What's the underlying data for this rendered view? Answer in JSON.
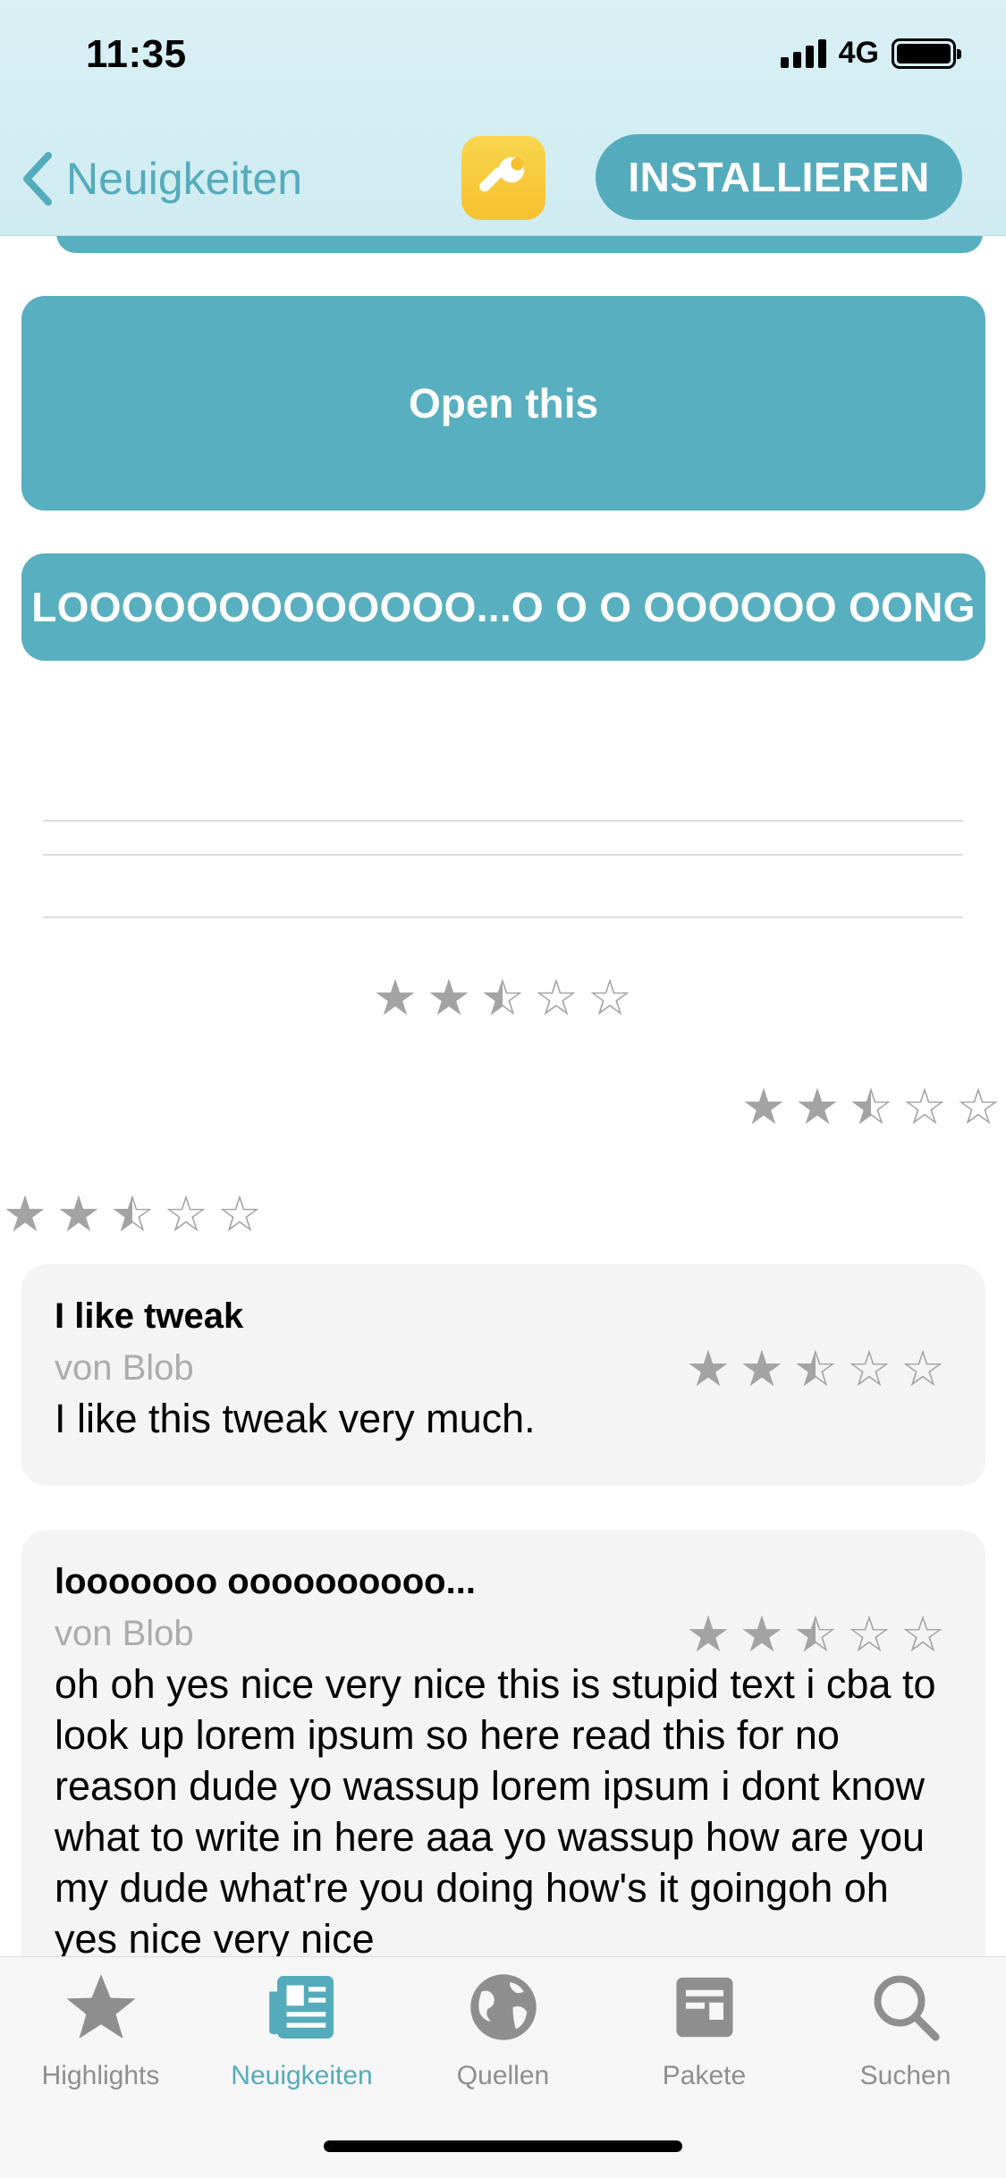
{
  "status_bar": {
    "time": "11:35",
    "network": "4G"
  },
  "nav": {
    "back_label": "Neuigkeiten",
    "install_label": "INSTALLIEREN"
  },
  "content": {
    "open_button": "Open this",
    "long_button": "LOOOOOOOOOOOOO...O O O OOOOOO OONG",
    "ratings": [
      {
        "stars": 2.5
      },
      {
        "stars": 2.5
      },
      {
        "stars": 2.5
      }
    ]
  },
  "reviews": [
    {
      "title": "I like tweak",
      "author": "von Blob",
      "stars": 2.5,
      "body": "I like this tweak very much."
    },
    {
      "title": "looooooo oooooooooo...",
      "author": "von Blob",
      "stars": 2.5,
      "body": "oh oh yes nice very nice this is stupid text i cba to look up lorem ipsum so here read this for no reason dude yo wassup lorem ipsum i dont know what to write in here aaa yo wassup how are you my dude what're you doing how's it goingoh oh yes nice very nice"
    }
  ],
  "tabs": [
    {
      "label": "Highlights",
      "icon": "star-icon",
      "active": false
    },
    {
      "label": "Neuigkeiten",
      "icon": "newspaper-icon",
      "active": true
    },
    {
      "label": "Quellen",
      "icon": "globe-icon",
      "active": false
    },
    {
      "label": "Pakete",
      "icon": "package-icon",
      "active": false
    },
    {
      "label": "Suchen",
      "icon": "search-icon",
      "active": false
    }
  ],
  "colors": {
    "accent": "#54abbc",
    "button": "#58afbf",
    "star": "#a3a3a3",
    "icon_yellow": "#f6c12f"
  }
}
